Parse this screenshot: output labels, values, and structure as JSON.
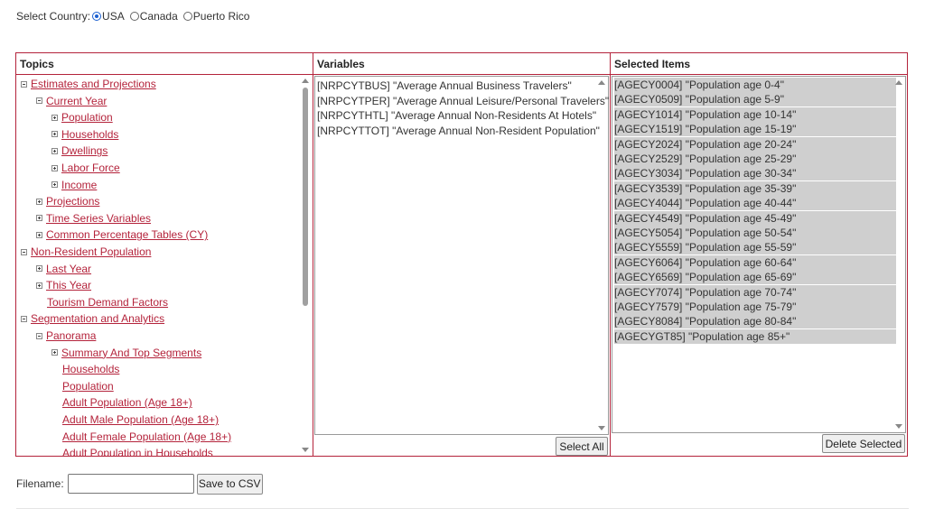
{
  "country": {
    "label": "Select Country:",
    "options": [
      {
        "label": "USA",
        "checked": true
      },
      {
        "label": "Canada",
        "checked": false
      },
      {
        "label": "Puerto Rico",
        "checked": false
      }
    ]
  },
  "topics": {
    "header": "Topics",
    "items": [
      {
        "label": "Estimates and Projections",
        "level": 0,
        "toggle": "minus"
      },
      {
        "label": "Current Year",
        "level": 1,
        "toggle": "minus"
      },
      {
        "label": "Population",
        "level": 2,
        "toggle": "plus"
      },
      {
        "label": "Households",
        "level": 2,
        "toggle": "plus"
      },
      {
        "label": "Dwellings",
        "level": 2,
        "toggle": "plus"
      },
      {
        "label": "Labor Force",
        "level": 2,
        "toggle": "plus"
      },
      {
        "label": "Income",
        "level": 2,
        "toggle": "plus"
      },
      {
        "label": "Projections",
        "level": 1,
        "toggle": "plus"
      },
      {
        "label": "Time Series Variables",
        "level": 1,
        "toggle": "plus"
      },
      {
        "label": "Common Percentage Tables (CY)",
        "level": 1,
        "toggle": "plus"
      },
      {
        "label": "Non-Resident Population",
        "level": 0,
        "toggle": "minus"
      },
      {
        "label": "Last Year",
        "level": 1,
        "toggle": "plus"
      },
      {
        "label": "This Year",
        "level": 1,
        "toggle": "plus"
      },
      {
        "label": "Tourism Demand Factors",
        "level": 1,
        "toggle": "none"
      },
      {
        "label": "Segmentation and Analytics",
        "level": 0,
        "toggle": "minus"
      },
      {
        "label": "Panorama",
        "level": 1,
        "toggle": "minus"
      },
      {
        "label": "Summary And Top Segments",
        "level": 2,
        "toggle": "plus"
      },
      {
        "label": "Households",
        "level": 2,
        "toggle": "none"
      },
      {
        "label": "Population",
        "level": 2,
        "toggle": "none"
      },
      {
        "label": "Adult Population (Age 18+)",
        "level": 2,
        "toggle": "none"
      },
      {
        "label": "Adult Male Population (Age 18+)",
        "level": 2,
        "toggle": "none"
      },
      {
        "label": "Adult Female Population (Age 18+)",
        "level": 2,
        "toggle": "none"
      },
      {
        "label": "Adult Population in Households",
        "level": 2,
        "toggle": "none"
      }
    ]
  },
  "variables": {
    "header": "Variables",
    "items": [
      "[NRPCYTBUS] \"Average Annual Business Travelers\"",
      "[NRPCYTPER] \"Average Annual Leisure/Personal Travelers\"",
      "[NRPCYTHTL] \"Average Annual Non-Residents At Hotels\"",
      "[NRPCYTTOT] \"Average Annual Non-Resident Population\""
    ],
    "select_all_label": "Select All"
  },
  "selected": {
    "header": "Selected Items",
    "items": [
      "[AGECY0004] \"Population age 0-4\"",
      "[AGECY0509] \"Population age 5-9\"",
      "[AGECY1014] \"Population age 10-14\"",
      "[AGECY1519] \"Population age 15-19\"",
      "[AGECY2024] \"Population age 20-24\"",
      "[AGECY2529] \"Population age 25-29\"",
      "[AGECY3034] \"Population age 30-34\"",
      "[AGECY3539] \"Population age 35-39\"",
      "[AGECY4044] \"Population age 40-44\"",
      "[AGECY4549] \"Population age 45-49\"",
      "[AGECY5054] \"Population age 50-54\"",
      "[AGECY5559] \"Population age 55-59\"",
      "[AGECY6064] \"Population age 60-64\"",
      "[AGECY6569] \"Population age 65-69\"",
      "[AGECY7074] \"Population age 70-74\"",
      "[AGECY7579] \"Population age 75-79\"",
      "[AGECY8084] \"Population age 80-84\"",
      "[AGECYGT85] \"Population age 85+\""
    ],
    "delete_label": "Delete Selected"
  },
  "file": {
    "label": "Filename:",
    "value": "",
    "save_label": "Save to CSV"
  },
  "colors": {
    "accent": "#b4233b",
    "selection": "#cfcfcf"
  }
}
